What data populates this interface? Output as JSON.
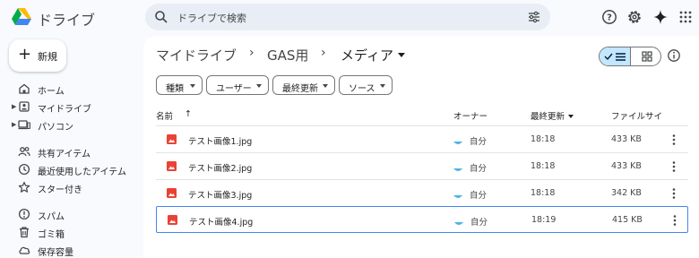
{
  "app": {
    "title": "ドライブ"
  },
  "search": {
    "placeholder": "ドライブで検索"
  },
  "header_icons": [
    "help-icon",
    "settings-icon",
    "gemini-sparkle-icon",
    "apps-grid-icon"
  ],
  "sidebar": {
    "new_label": "新規",
    "items": [
      {
        "label": "ホーム",
        "icon": "home-icon"
      },
      {
        "label": "マイドライブ",
        "icon": "my-drive-icon",
        "expandable": true
      },
      {
        "label": "パソコン",
        "icon": "computer-icon",
        "expandable": true
      },
      {
        "label": "共有アイテム",
        "icon": "shared-icon"
      },
      {
        "label": "最近使用したアイテム",
        "icon": "clock-icon"
      },
      {
        "label": "スター付き",
        "icon": "star-icon"
      },
      {
        "label": "スパム",
        "icon": "spam-icon"
      },
      {
        "label": "ゴミ箱",
        "icon": "trash-icon"
      },
      {
        "label": "保存容量",
        "icon": "cloud-icon"
      }
    ]
  },
  "breadcrumb": {
    "items": [
      "マイドライブ",
      "GAS用"
    ],
    "current": "メディア",
    "separator": "›"
  },
  "filters": [
    {
      "label": "種類"
    },
    {
      "label": "ユーザー"
    },
    {
      "label": "最終更新"
    },
    {
      "label": "ソース"
    }
  ],
  "table": {
    "headers": {
      "name": "名前",
      "sort_arrow": "↑",
      "owner": "オーナー",
      "modified": "最終更新",
      "size": "ファイルサイ"
    },
    "rows": [
      {
        "name": "テスト画像1.jpg",
        "owner": "自分",
        "modified": "18:18",
        "size": "433 KB",
        "selected": false
      },
      {
        "name": "テスト画像2.jpg",
        "owner": "自分",
        "modified": "18:18",
        "size": "433 KB",
        "selected": false
      },
      {
        "name": "テスト画像3.jpg",
        "owner": "自分",
        "modified": "18:18",
        "size": "342 KB",
        "selected": false
      },
      {
        "name": "テスト画像4.jpg",
        "owner": "自分",
        "modified": "18:19",
        "size": "415 KB",
        "selected": true
      }
    ]
  },
  "colors": {
    "accent": "#0b57d0",
    "image_file": "#e94235",
    "selected_border": "#4285f4",
    "view_toggle_active": "#c2e7ff",
    "search_bg": "#e9eef6"
  }
}
